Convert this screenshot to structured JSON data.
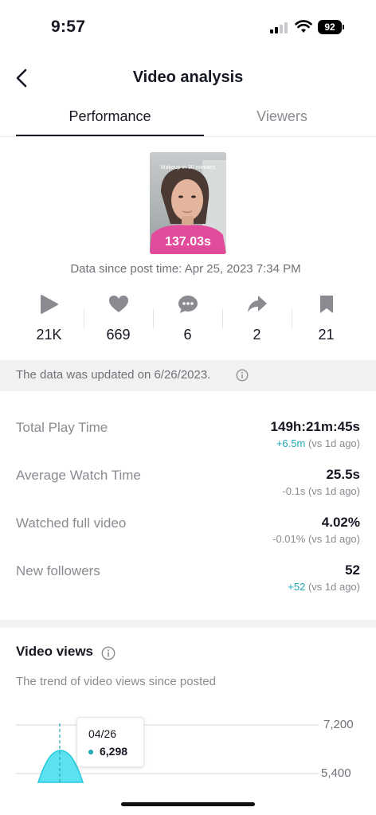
{
  "status_bar": {
    "time": "9:57",
    "battery": "92"
  },
  "nav": {
    "title": "Video analysis"
  },
  "tabs": [
    {
      "label": "Performance"
    },
    {
      "label": "Viewers"
    }
  ],
  "video": {
    "caption": "Makeup in 30 minutes",
    "duration": "137.03s"
  },
  "data_since": "Data since post time: Apr 25, 2023 7:34 PM",
  "stats": [
    {
      "icon": "play-icon",
      "value": "21K"
    },
    {
      "icon": "heart-icon",
      "value": "669"
    },
    {
      "icon": "comment-icon",
      "value": "6"
    },
    {
      "icon": "share-icon",
      "value": "2"
    },
    {
      "icon": "bookmark-icon",
      "value": "21"
    }
  ],
  "update_notice": "The data was updated on 6/26/2023.",
  "metrics": [
    {
      "label": "Total Play Time",
      "value": "149h:21m:45s",
      "delta": "+6.5m",
      "delta_suffix": " (vs 1d ago)"
    },
    {
      "label": "Average Watch Time",
      "value": "25.5s",
      "delta": "-0.1s",
      "delta_suffix": " (vs 1d ago)"
    },
    {
      "label": "Watched full video",
      "value": "4.02%",
      "delta": "-0.01%",
      "delta_suffix": " (vs 1d ago)"
    },
    {
      "label": "New followers",
      "value": "52",
      "delta": "+52",
      "delta_suffix": " (vs 1d ago)"
    }
  ],
  "video_views": {
    "title": "Video views",
    "subtitle": "The trend of video views since posted",
    "tooltip": {
      "date": "04/26",
      "value": "6,298"
    }
  },
  "colors": {
    "accent": "#20a9b5",
    "chart_fill": "#5ce1f0",
    "text_primary": "#161823",
    "text_secondary": "#8a8b91"
  },
  "chart_data": {
    "type": "area",
    "x": [
      "04/26"
    ],
    "series": [
      {
        "values": [
          6298
        ]
      }
    ],
    "y_ticks": [
      "7,200",
      "5,400"
    ],
    "ylim": [
      5400,
      7200
    ],
    "grid": true
  }
}
